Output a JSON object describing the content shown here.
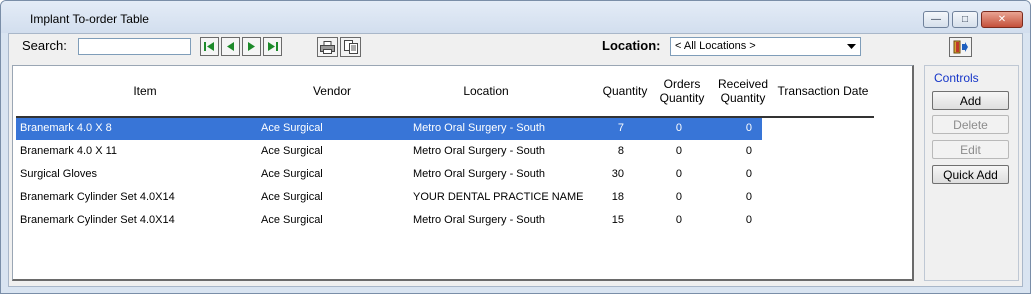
{
  "window": {
    "title": "Implant To-order Table"
  },
  "toolbar": {
    "search_label": "Search:",
    "search_value": "",
    "location_label": "Location:",
    "location_selected": "< All Locations >"
  },
  "table": {
    "columns": [
      "Item",
      "Vendor",
      "Location",
      "Quantity",
      "Orders Quantity",
      "Received Quantity",
      "Transaction Date"
    ],
    "rows": [
      {
        "item": "Branemark 4.0 X 8",
        "vendor": "Ace Surgical",
        "location": "Metro Oral Surgery - South",
        "quantity": "7",
        "orders": "0",
        "received": "0",
        "date": ""
      },
      {
        "item": "Branemark 4.0 X 11",
        "vendor": "Ace Surgical",
        "location": "Metro Oral Surgery - South",
        "quantity": "8",
        "orders": "0",
        "received": "0",
        "date": ""
      },
      {
        "item": "Surgical Gloves",
        "vendor": "Ace Surgical",
        "location": "Metro Oral Surgery - South",
        "quantity": "30",
        "orders": "0",
        "received": "0",
        "date": ""
      },
      {
        "item": "Branemark Cylinder Set 4.0X14",
        "vendor": "Ace Surgical",
        "location": "YOUR DENTAL PRACTICE NAME",
        "quantity": "18",
        "orders": "0",
        "received": "0",
        "date": ""
      },
      {
        "item": "Branemark Cylinder Set 4.0X14",
        "vendor": "Ace Surgical",
        "location": "Metro Oral Surgery - South",
        "quantity": "15",
        "orders": "0",
        "received": "0",
        "date": ""
      }
    ],
    "selected_row": 0,
    "selection_color": "#3875d7"
  },
  "controls": {
    "title": "Controls",
    "buttons": [
      "Add",
      "Delete",
      "Edit",
      "Quick Add"
    ],
    "title_color": "#1535c8"
  },
  "icons": {
    "nav": [
      "first-record-icon",
      "previous-record-icon",
      "next-record-icon",
      "last-record-icon"
    ],
    "tools": [
      "printer-icon",
      "copy-icon"
    ],
    "exit": "exit-door-icon"
  }
}
